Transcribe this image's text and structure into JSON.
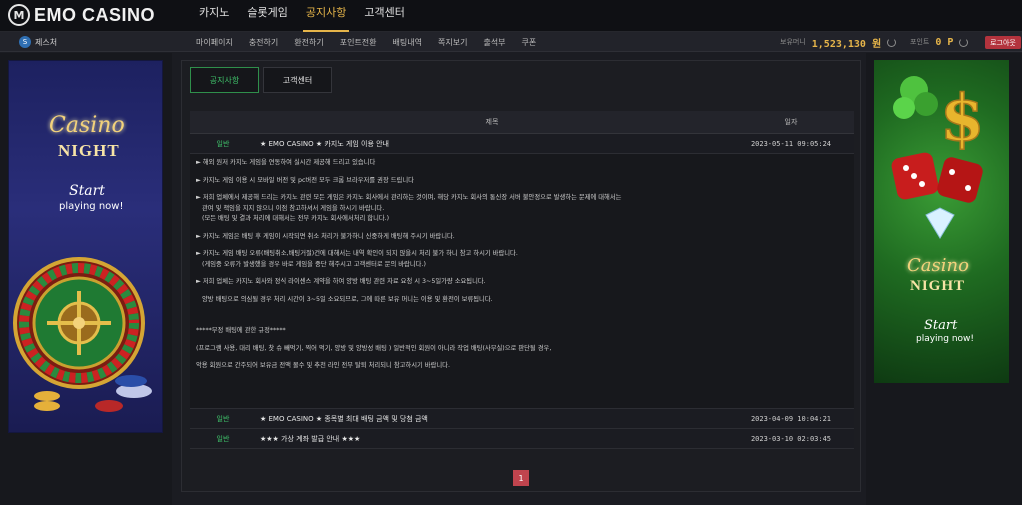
{
  "app": {
    "logo_mark": "M",
    "logo_text": "EMO CASINO"
  },
  "main_menu": [
    {
      "label": "카지노"
    },
    {
      "label": "슬롯게임"
    },
    {
      "label": "공지사항",
      "active": true
    },
    {
      "label": "고객센터"
    }
  ],
  "user": {
    "icon": "S",
    "name": "제스처"
  },
  "sub_menu": [
    {
      "label": "마이페이지"
    },
    {
      "label": "충전하기"
    },
    {
      "label": "환전하기"
    },
    {
      "label": "포인트전환"
    },
    {
      "label": "배팅내역"
    },
    {
      "label": "쪽지보기"
    },
    {
      "label": "출석부"
    },
    {
      "label": "쿠폰"
    }
  ],
  "wallet": {
    "balance_label": "보유머니",
    "balance_value": "1,523,130 원",
    "points_label": "포인트",
    "points_value": "0 P",
    "logout_label": "로그아웃"
  },
  "banner_left": {
    "line1": "Casino",
    "line2": "NIGHT",
    "line3": "Start",
    "line4": "playing now!"
  },
  "banner_right": {
    "line1": "Casino",
    "line2": "NIGHT",
    "line3": "Start",
    "line4": "playing now!"
  },
  "tabs": [
    {
      "label": "공지사항",
      "active": true
    },
    {
      "label": "고객센터"
    }
  ],
  "table": {
    "col_title": "제목",
    "col_date": "일자",
    "rows": [
      {
        "type": "일반",
        "title": "★ EMO CASINO ★ 카지노 게임 이용 안내",
        "date": "2023-05-11 09:05:24"
      },
      {
        "type": "일반",
        "title": "★ EMO CASINO ★ 종목별 최대 배팅 금액 및 당첨 금액",
        "date": "2023-04-09 10:04:21"
      },
      {
        "type": "일반",
        "title": "★★★ 가상 계좌 발급 안내 ★★★",
        "date": "2023-03-10 02:03:45"
      }
    ]
  },
  "notice_lines": [
    "► 해외 원저 카지노 게임을 연동하여 실시간 제공해 드리고 있습니다",
    "► 카지노 게임 이용 시 모바일 버전 및 pc버전 모두 크롬 브라우저를 권장 드립니다",
    "► 저희 업체에서 제공해 드리는 카지노 관련 모든 게임은 카지노 회사에서 관리하는 것이며, 해당 카지노 회사의 통신장 서버 불안정으로 발생하는 문제에 대해서는",
    "관여 및 책임을 지지 않으니 이점 참고하셔서 게임을 하시기 바랍니다.",
    "(모든 배팅 및 결과 처리에 대해서는 전부 카지노 회사에서처리 합니다.)",
    "► 카지노 게임은 배팅 후 게임이 시작되면 취소 처리가 불가하니 신중하게 배팅해 주시기 바랍니다.",
    "► 카지노 게임 배팅 오류(배팅취소,배팅거절)건에 대해서는 내역 확인이 되지 않을시 처리 불가 하니 참고 하시기 바랍니다.",
    "(게임중 오류가 발생했을 경우 바로 게임을 중단 해주시고 고객센터로 문의 바랍니다.)",
    "► 저희 업체는 카지노 회사와 정식 라이센스 계약을 하여 양방 배팅 관련 자료 요청 시 3~5일가량 소요됩니다.",
    "양방 배팅으로 의심될 경우 처리 시간이 3~5일 소요되므로, 그에 따른 보유 머니는 이용 및 환전이 보류됩니다.",
    "*****부정 배팅에 관한 규정*****",
    "(프로그램 사용, 대리 배팅, 찻 슈 빼먹기, 찍어 먹기, 양방 및 양방성 배팅 ) 일반적인 회원이 아니라 작업 배팅(사무실)으로 판단될 경우,",
    "악용 회원으로 간주되어 보유금 전액 몰수 및 추천 라인 전부 탈퇴 처리되니 참고하시기 바랍니다."
  ],
  "pagination": {
    "current": "1"
  }
}
